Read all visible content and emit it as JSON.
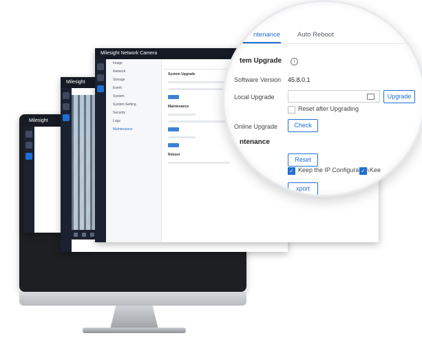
{
  "brand": {
    "logo_text": "Milesight",
    "app_title": "Network Camera"
  },
  "magnifier": {
    "tabs": [
      {
        "label": "ntenance",
        "active": true
      },
      {
        "label": "Auto Reboot",
        "active": false
      }
    ],
    "system_upgrade": {
      "heading": "tem Upgrade",
      "software_version_label": "Software Version",
      "software_version_value": "45.8.0.1",
      "local_upgrade_label": "Local Upgrade",
      "upgrade_button": "Upgrade",
      "reset_after_upgrading_label": "Reset after Upgrading",
      "reset_after_upgrading_checked": false,
      "online_upgrade_label": "Online Upgrade",
      "check_button": "Check"
    },
    "maintenance": {
      "heading": "ntenance",
      "reset_button": "Reset",
      "keep_ip_label": "Keep the IP Configuration",
      "keep_ip_checked": true,
      "keep_second_label": "Kee",
      "keep_second_checked": true,
      "export_button": "xport"
    }
  },
  "background_window": {
    "sidebar_items": [
      "Image",
      "Network",
      "Storage",
      "Event",
      "System"
    ],
    "sub_items": [
      "System Setting",
      "Security",
      "Logs",
      "Maintenance"
    ],
    "section_titles": [
      "System Upgrade",
      "Maintenance",
      "Reboot"
    ]
  },
  "colors": {
    "accent": "#1f6fd1",
    "topbar": "#151a25",
    "sidebar_dark": "#1b2130"
  }
}
